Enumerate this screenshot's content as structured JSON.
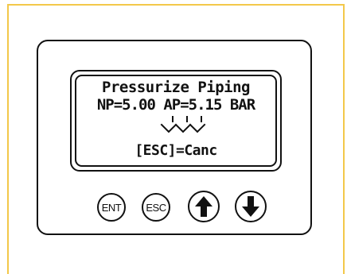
{
  "display": {
    "line1": "Pressurize Piping",
    "line2": "NP=5.00 AP=5.15 BAR",
    "line3": "[ESC]=Canc",
    "indicator_icon": "triple-down-chevron-icon"
  },
  "buttons": {
    "ent_label": "ENT",
    "esc_label": "ESC",
    "up_icon": "arrow-up-icon",
    "down_icon": "arrow-down-icon"
  },
  "colors": {
    "frame_border": "#f3c84a",
    "ink": "#111111"
  }
}
